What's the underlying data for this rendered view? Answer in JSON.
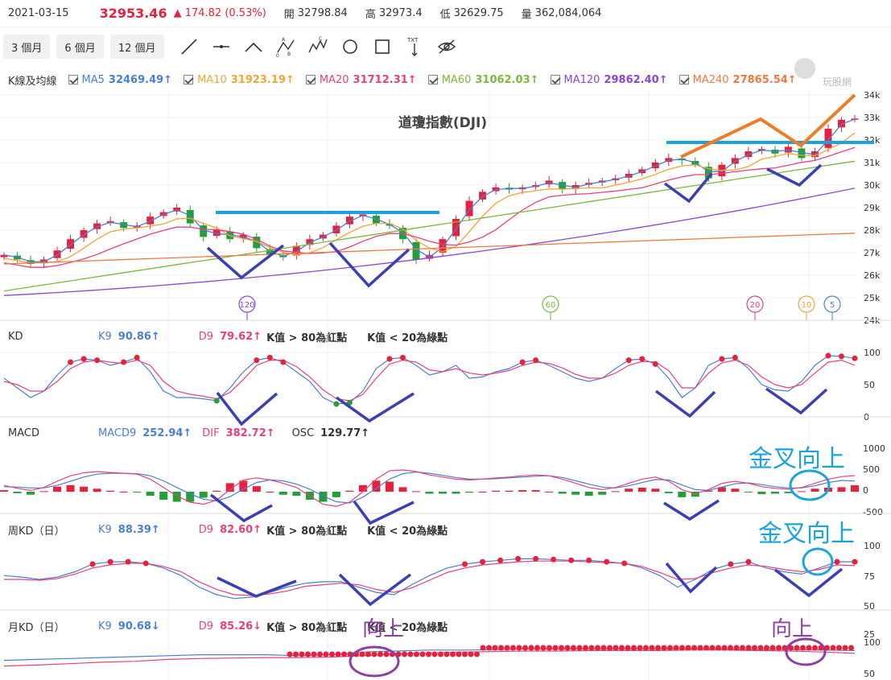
{
  "header": {
    "date": "2021-03-15",
    "price": "32953.46",
    "change": "▲ 174.82 (0.53%)",
    "open_label": "開",
    "open": "32798.84",
    "high_label": "高",
    "high": "32973.4",
    "low_label": "低",
    "low": "32629.75",
    "vol_label": "量",
    "vol": "362,084,064"
  },
  "toolbar": {
    "periods": [
      "3 個月",
      "6 個月",
      "12 個月"
    ]
  },
  "colors": {
    "up": "#e8203a",
    "down": "#21a037",
    "ma5": "#4a7fd6",
    "ma10": "#f2a533",
    "ma20": "#e9407a",
    "ma60": "#7bb93b",
    "ma120": "#8e44d8",
    "ma240": "#f07840",
    "annot_blue": "#3b3fb7",
    "annot_cyan": "#1aa3de",
    "annot_orange": "#f07b22",
    "annot_purple": "#8e3fa6"
  },
  "main": {
    "legend_label": "K線及均線",
    "ma": [
      {
        "key": "ma5",
        "name": "MA5",
        "value": "32469.49↑"
      },
      {
        "key": "ma10",
        "name": "MA10",
        "value": "31923.19↑"
      },
      {
        "key": "ma20",
        "name": "MA20",
        "value": "31712.31↑"
      },
      {
        "key": "ma60",
        "name": "MA60",
        "value": "31062.03↑"
      },
      {
        "key": "ma120",
        "name": "MA120",
        "value": "29862.40↑"
      },
      {
        "key": "ma240",
        "name": "MA240",
        "value": "27865.54↑"
      }
    ],
    "title": "道瓊指數(DJI)",
    "watermark": "玩股網",
    "y_ticks": [
      "34k",
      "33k",
      "32k",
      "31k",
      "30k",
      "29k",
      "28k",
      "27k",
      "26k",
      "25k",
      "24k"
    ],
    "cross_markers": [
      "120",
      "60",
      "20",
      "10",
      "5"
    ]
  },
  "kd": {
    "label": "KD",
    "k_label": "K9",
    "k_value": "90.86↑",
    "d_label": "D9",
    "d_value": "79.62↑",
    "note1": "K值 > 80為紅點",
    "note2": "K值 < 20為綠點",
    "y_ticks": [
      "100",
      "50",
      "0"
    ]
  },
  "macd": {
    "label": "MACD",
    "macd_label": "MACD9",
    "macd_value": "252.94↑",
    "dif_label": "DIF",
    "dif_value": "382.72↑",
    "osc_label": "OSC",
    "osc_value": "129.77↑",
    "y_ticks": [
      "1000",
      "500",
      "0",
      "-500"
    ],
    "annotation": "金叉向上"
  },
  "weekly_kd": {
    "label": "周KD（日）",
    "k_label": "K9",
    "k_value": "88.39↑",
    "d_label": "D9",
    "d_value": "82.60↑",
    "note1": "K值 > 80為紅點",
    "note2": "K值 < 20為綠點",
    "y_ticks": [
      "100",
      "75",
      "50",
      "25"
    ],
    "annotation": "金叉向上"
  },
  "monthly_kd": {
    "label": "月KD（日）",
    "k_label": "K9",
    "k_value": "90.68↓",
    "d_label": "D9",
    "d_value": "85.26↓",
    "note1": "K值 > 80為紅點",
    "note2": "K值 < 20為綠點",
    "y_ticks": [
      "100",
      "50"
    ],
    "annotation_1": "向上",
    "annotation_2": "向上"
  },
  "chart_data": {
    "type": "line",
    "title": "道瓊指數(DJI)",
    "end_date": "2021-03-15",
    "price_ylim": [
      24000,
      34000
    ],
    "price_path": [
      26900,
      26700,
      26500,
      26700,
      27100,
      27600,
      28000,
      28300,
      28400,
      28100,
      28200,
      28600,
      28800,
      29000,
      28300,
      27700,
      28000,
      27600,
      27800,
      27200,
      26900,
      26800,
      27300,
      27600,
      27800,
      28200,
      28600,
      28700,
      28300,
      28200,
      27600,
      26700,
      26900,
      27600,
      28500,
      29300,
      29700,
      29900,
      29800,
      29900,
      30000,
      30200,
      29800,
      30000,
      30100,
      30200,
      30300,
      30500,
      30700,
      31000,
      31200,
      31100,
      30900,
      30300,
      30900,
      31200,
      31500,
      31600,
      31400,
      31700,
      31200,
      31500,
      32500,
      32900,
      32953
    ],
    "ma_end_values": {
      "MA5": 32469.49,
      "MA10": 31923.19,
      "MA20": 31712.31,
      "MA60": 31062.03,
      "MA120": 29862.4,
      "MA240": 27865.54
    },
    "kd_k": [
      60,
      45,
      30,
      40,
      65,
      85,
      90,
      88,
      80,
      85,
      92,
      70,
      40,
      30,
      30,
      28,
      25,
      45,
      70,
      88,
      92,
      85,
      70,
      55,
      30,
      20,
      22,
      40,
      75,
      90,
      92,
      80,
      65,
      70,
      80,
      60,
      62,
      70,
      75,
      85,
      88,
      80,
      70,
      60,
      55,
      60,
      75,
      88,
      90,
      82,
      60,
      30,
      45,
      80,
      90,
      92,
      75,
      50,
      42,
      40,
      55,
      80,
      95,
      94,
      91
    ],
    "kd_d": [
      55,
      50,
      40,
      40,
      55,
      75,
      85,
      88,
      85,
      83,
      88,
      80,
      55,
      40,
      35,
      32,
      28,
      38,
      58,
      80,
      88,
      88,
      78,
      62,
      42,
      28,
      25,
      35,
      60,
      82,
      88,
      85,
      73,
      70,
      75,
      68,
      65,
      68,
      72,
      80,
      85,
      83,
      76,
      66,
      60,
      60,
      68,
      80,
      86,
      85,
      72,
      45,
      45,
      68,
      84,
      88,
      80,
      62,
      50,
      45,
      50,
      68,
      85,
      88,
      80
    ],
    "macd_dif": [
      150,
      80,
      30,
      100,
      250,
      380,
      450,
      480,
      460,
      440,
      420,
      300,
      100,
      -100,
      -250,
      -300,
      -200,
      50,
      280,
      330,
      280,
      200,
      100,
      -100,
      -300,
      -350,
      -250,
      0,
      300,
      500,
      520,
      480,
      400,
      350,
      300,
      280,
      300,
      330,
      350,
      380,
      400,
      380,
      300,
      200,
      100,
      50,
      100,
      200,
      300,
      350,
      250,
      50,
      -50,
      50,
      200,
      250,
      200,
      120,
      80,
      60,
      100,
      200,
      300,
      360,
      382
    ],
    "macd_signal": [
      120,
      110,
      90,
      90,
      150,
      250,
      350,
      420,
      440,
      440,
      430,
      380,
      260,
      100,
      -50,
      -180,
      -220,
      -120,
      60,
      220,
      280,
      260,
      180,
      60,
      -100,
      -240,
      -270,
      -130,
      80,
      300,
      430,
      470,
      440,
      390,
      340,
      300,
      300,
      310,
      330,
      350,
      370,
      380,
      340,
      260,
      180,
      110,
      90,
      140,
      220,
      290,
      280,
      160,
      50,
      30,
      110,
      190,
      210,
      170,
      120,
      90,
      90,
      140,
      220,
      270,
      253
    ],
    "weekly_k": [
      70,
      68,
      65,
      68,
      75,
      85,
      88,
      88,
      86,
      80,
      70,
      55,
      45,
      40,
      42,
      48,
      55,
      60,
      62,
      62,
      55,
      48,
      45,
      58,
      70,
      80,
      85,
      88,
      90,
      92,
      92,
      91,
      90,
      90,
      88,
      86,
      80,
      70,
      55,
      65,
      78,
      85,
      88,
      80,
      75,
      72,
      80,
      88,
      88
    ],
    "weekly_d": [
      65,
      65,
      64,
      66,
      72,
      80,
      84,
      86,
      86,
      82,
      75,
      62,
      52,
      45,
      44,
      46,
      50,
      56,
      58,
      60,
      58,
      52,
      48,
      54,
      64,
      74,
      80,
      84,
      86,
      88,
      89,
      89,
      89,
      88,
      87,
      86,
      82,
      74,
      65,
      66,
      74,
      80,
      84,
      82,
      78,
      75,
      78,
      84,
      83
    ],
    "monthly_k": [
      70,
      72,
      74,
      76,
      78,
      80,
      82,
      82,
      82,
      80,
      82,
      88,
      90,
      92,
      92,
      93,
      94,
      94,
      94,
      94,
      94,
      95,
      94,
      93,
      93,
      92,
      91
    ],
    "monthly_d": [
      58,
      60,
      63,
      66,
      68,
      72,
      74,
      75,
      76,
      76,
      77,
      80,
      84,
      86,
      88,
      89,
      90,
      90,
      91,
      91,
      91,
      92,
      92,
      91,
      90,
      88,
      85
    ],
    "kd_ylim": [
      0,
      100
    ],
    "macd_ylim": [
      -700,
      1100
    ],
    "weekly_kd_ylim": [
      25,
      110
    ],
    "monthly_kd_ylim": [
      40,
      110
    ]
  }
}
